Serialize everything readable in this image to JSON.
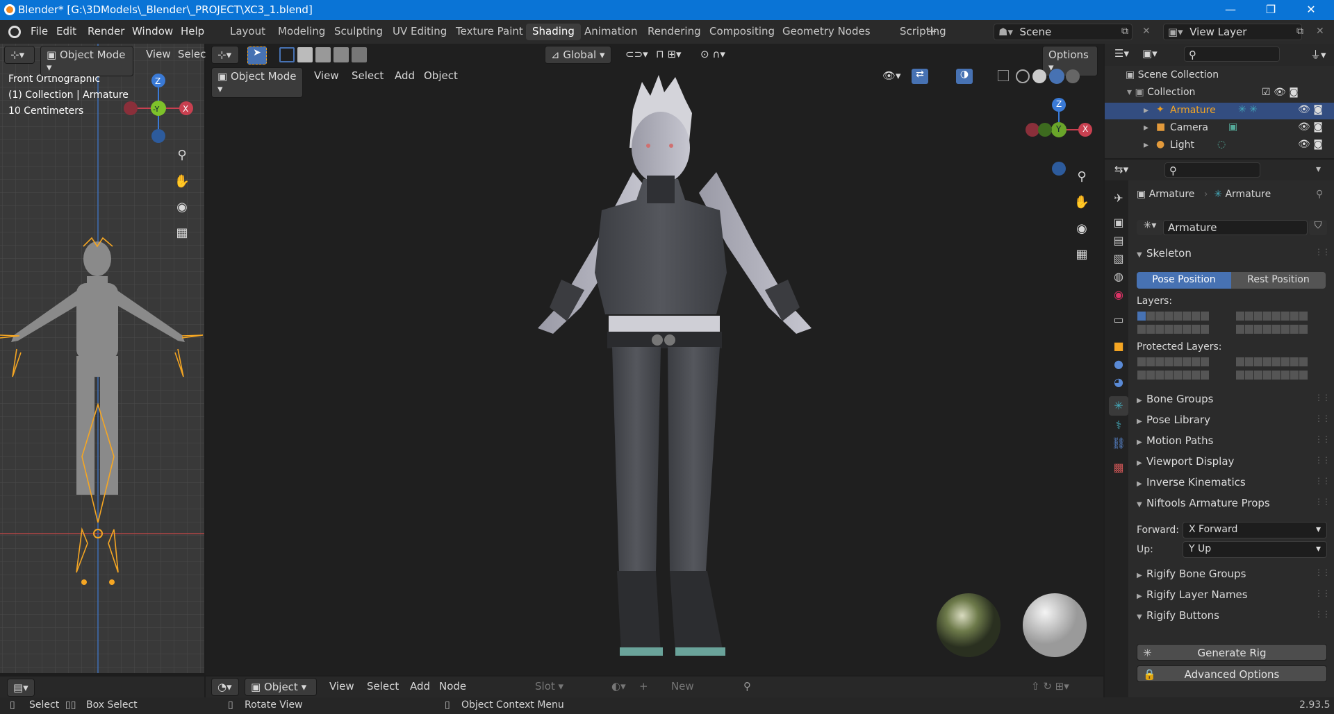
{
  "title": "Blender* [G:\\3DModels\\_Blender\\_PROJECT\\XC3_1.blend]",
  "menus": [
    "File",
    "Edit",
    "Render",
    "Window",
    "Help"
  ],
  "workspaces": [
    "Layout",
    "Modeling",
    "Sculpting",
    "UV Editing",
    "Texture Paint",
    "Shading",
    "Animation",
    "Rendering",
    "Compositing",
    "Geometry Nodes",
    "Scripting"
  ],
  "active_workspace": "Shading",
  "scene": "Scene",
  "view_layer": "View Layer",
  "left_viewport": {
    "mode": "Object Mode",
    "view_menu": "View",
    "select_menu": "Selec",
    "overlay_lines": [
      "Front Orthographic",
      "(1) Collection | Armature",
      "10 Centimeters"
    ],
    "gizmo": {
      "z": "Z",
      "y": "-Y",
      "x": "X"
    }
  },
  "main_viewport": {
    "mode": "Object Mode",
    "menus": [
      "View",
      "Select",
      "Add",
      "Object"
    ],
    "transform": "Global",
    "options": "Options",
    "gizmo": {
      "z": "Z",
      "y": "Y",
      "x": "X"
    }
  },
  "node_header": {
    "editor": "Object",
    "menus": [
      "View",
      "Select",
      "Add",
      "Node"
    ],
    "slot": "Slot",
    "new": "New"
  },
  "outliner": {
    "root": "Scene Collection",
    "collection": "Collection",
    "items": [
      {
        "label": "Armature",
        "selected": true
      },
      {
        "label": "Camera",
        "selected": false
      },
      {
        "label": "Light",
        "selected": false
      }
    ]
  },
  "properties": {
    "breadcrumb": [
      "Armature",
      "Armature"
    ],
    "data_name": "Armature",
    "skeleton": "Skeleton",
    "pose_position": "Pose Position",
    "rest_position": "Rest Position",
    "layers": "Layers:",
    "protected_layers": "Protected Layers:",
    "collapsed_panels_1": [
      "Bone Groups",
      "Pose Library",
      "Motion Paths",
      "Viewport Display",
      "Inverse Kinematics"
    ],
    "niftools": "Niftools Armature Props",
    "forward_label": "Forward:",
    "forward_value": "X Forward",
    "up_label": "Up:",
    "up_value": "Y Up",
    "collapsed_panels_2": [
      "Rigify Bone Groups",
      "Rigify Layer Names"
    ],
    "rigify_buttons": "Rigify Buttons",
    "generate_rig": "Generate Rig",
    "advanced_options": "Advanced Options"
  },
  "status": {
    "select": "Select",
    "box_select": "Box Select",
    "rotate_view": "Rotate View",
    "context_menu": "Object Context Menu",
    "version": "2.93.5"
  },
  "colors": {
    "accent": "#4772b3",
    "orange": "#f5a623",
    "titlebar": "#0a74d6"
  }
}
